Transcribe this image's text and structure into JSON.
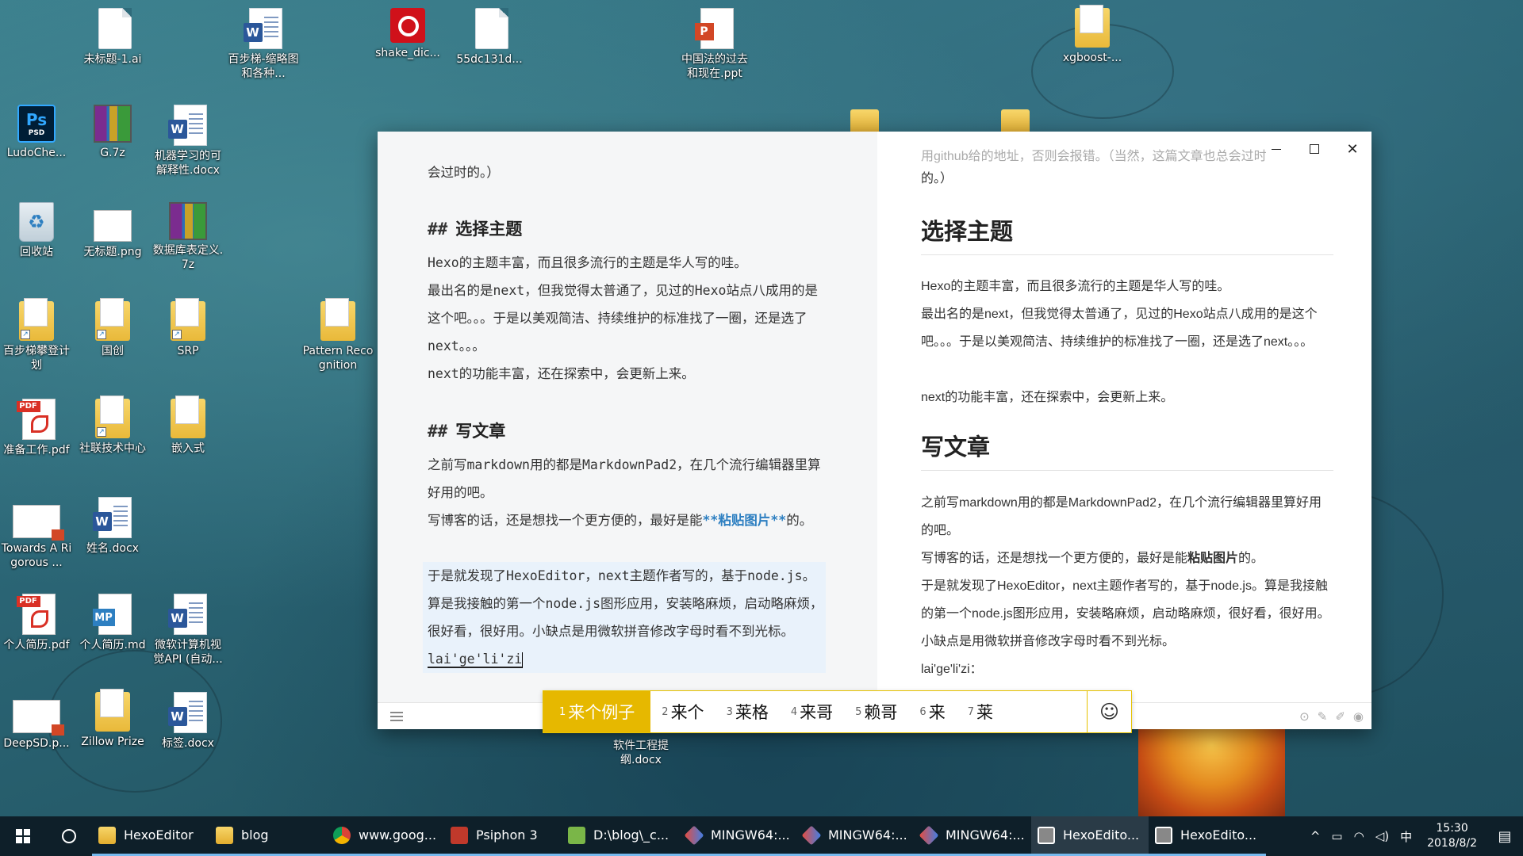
{
  "desktop": {
    "icons": [
      {
        "label": "未标题-1.ai",
        "type": "doc"
      },
      {
        "label": "百步梯-缩略图和各种...",
        "type": "word"
      },
      {
        "label": "shake_dic...",
        "type": "netease"
      },
      {
        "label": "55dc131d...",
        "type": "doc"
      },
      {
        "label": "中国法的过去和现在.ppt",
        "type": "ppt"
      },
      {
        "label": "xgboost-...",
        "type": "folder"
      },
      {
        "label": "LudoChe...",
        "type": "ps"
      },
      {
        "label": "G.7z",
        "type": "rar"
      },
      {
        "label": "机器学习的可解释性.docx",
        "type": "word"
      },
      {
        "label": "回收站",
        "type": "recycle"
      },
      {
        "label": "无标题.png",
        "type": "png"
      },
      {
        "label": "数据库表定义.7z",
        "type": "rar"
      },
      {
        "label": "百步梯攀登计划",
        "type": "folder"
      },
      {
        "label": "国创",
        "type": "folder"
      },
      {
        "label": "SRP",
        "type": "folder"
      },
      {
        "label": "Pattern Recognition",
        "type": "folder"
      },
      {
        "label": "准备工作.pdf",
        "type": "pdf"
      },
      {
        "label": "社联技术中心",
        "type": "folder"
      },
      {
        "label": "嵌入式",
        "type": "folder"
      },
      {
        "label": "Towards A Rigorous ...",
        "type": "thumb"
      },
      {
        "label": "姓名.docx",
        "type": "word"
      },
      {
        "label": "个人简历.pdf",
        "type": "pdf"
      },
      {
        "label": "个人简历.md",
        "type": "md"
      },
      {
        "label": "微软计算机视觉API (自动...",
        "type": "word"
      },
      {
        "label": "DeepSD.p...",
        "type": "thumb"
      },
      {
        "label": "Zillow Prize",
        "type": "folder"
      },
      {
        "label": "标签.docx",
        "type": "word"
      }
    ],
    "behind_ime_label": "软件工程提纲.docx"
  },
  "editor": {
    "markdown": {
      "line_top": "会过时的。）",
      "h_select_theme": "选择主题",
      "hash": "##",
      "p1": "Hexo的主题丰富，而且很多流行的主题是华人写的哇。",
      "p2": "最出名的是next，但我觉得太普通了，见过的Hexo站点八成用的是这个吧。。。于是以美观简洁、持续维护的标准找了一圈，还是选了next。。。",
      "p3": "next的功能丰富，还在探索中，会更新上来。",
      "h_write": "写文章",
      "p4": "之前写markdown用的都是MarkdownPad2，在几个流行编辑器里算好用的吧。",
      "p5_pre": "写博客的话，还是想找一个更方便的，最好是能",
      "p5_bold": "**粘贴图片**",
      "p5_post": "的。",
      "p6": "于是就发现了HexoEditor，next主题作者写的，基于node.js。算是我接触的第一个node.js图形应用，安装略麻烦，启动略麻烦，很好看，很好用。小缺点是用微软拼音修改字母时看不到光标。",
      "p6_composing": "lai'ge'li'zi"
    },
    "preview": {
      "line_top_faded": "用github给的地址，否则会报错。（当然，这篇文章也总会过时",
      "line_top2": "的。）",
      "h_select_theme": "选择主题",
      "p1": "Hexo的主题丰富，而且很多流行的主题是华人写的哇。",
      "p2": "最出名的是next，但我觉得太普通了，见过的Hexo站点八成用的是这个吧。。。于是以美观简洁、持续维护的标准找了一圈，还是选了next。。。",
      "p3": "next的功能丰富，还在探索中，会更新上来。",
      "h_write": "写文章",
      "p4": "之前写markdown用的都是MarkdownPad2，在几个流行编辑器里算好用的吧。",
      "p5_pre": "写博客的话，还是想找一个更方便的，最好是能",
      "p5_bold": "粘贴图片",
      "p5_post": "的。",
      "p6": "于是就发现了HexoEditor，next主题作者写的，基于node.js。算是我接触的第一个node.js图形应用，安装略麻烦，启动略麻烦，很好看，很好用。小缺点是用微软拼音修改字母时看不到光标。",
      "p7": "lai'ge'li'zi："
    },
    "window_buttons": {
      "minimize": "—",
      "maximize": "□",
      "close": "✕"
    },
    "bottom_tools": [
      "⊙",
      "✎",
      "✐",
      "◉"
    ]
  },
  "ime": {
    "candidates": [
      {
        "n": "1",
        "text": "来个例子"
      },
      {
        "n": "2",
        "text": "来个"
      },
      {
        "n": "3",
        "text": "莱格"
      },
      {
        "n": "4",
        "text": "来哥"
      },
      {
        "n": "5",
        "text": "赖哥"
      },
      {
        "n": "6",
        "text": "来"
      },
      {
        "n": "7",
        "text": "莱"
      }
    ],
    "emoji": "☺"
  },
  "taskbar": {
    "items": [
      {
        "label": "HexoEditor",
        "icon": "folder",
        "active": false
      },
      {
        "label": "blog",
        "icon": "folder",
        "active": false
      },
      {
        "label": "www.goog...",
        "icon": "chrome",
        "active": false
      },
      {
        "label": "Psiphon 3",
        "icon": "psiphon",
        "active": false
      },
      {
        "label": "D:\\blog\\_c...",
        "icon": "notepad",
        "active": false
      },
      {
        "label": "MINGW64:...",
        "icon": "git",
        "active": false
      },
      {
        "label": "MINGW64:...",
        "icon": "git",
        "active": false
      },
      {
        "label": "MINGW64:...",
        "icon": "git",
        "active": false
      },
      {
        "label": "HexoEdito...",
        "icon": "hexo",
        "active": true
      },
      {
        "label": "HexoEdito...",
        "icon": "hexo",
        "active": false
      }
    ],
    "tray": {
      "chevron": "^",
      "battery": "▭",
      "wifi": "◠",
      "volume": "◁)",
      "ime_mode": "中",
      "time": "15:30",
      "date": "2018/8/2",
      "notifications": "▤"
    }
  }
}
